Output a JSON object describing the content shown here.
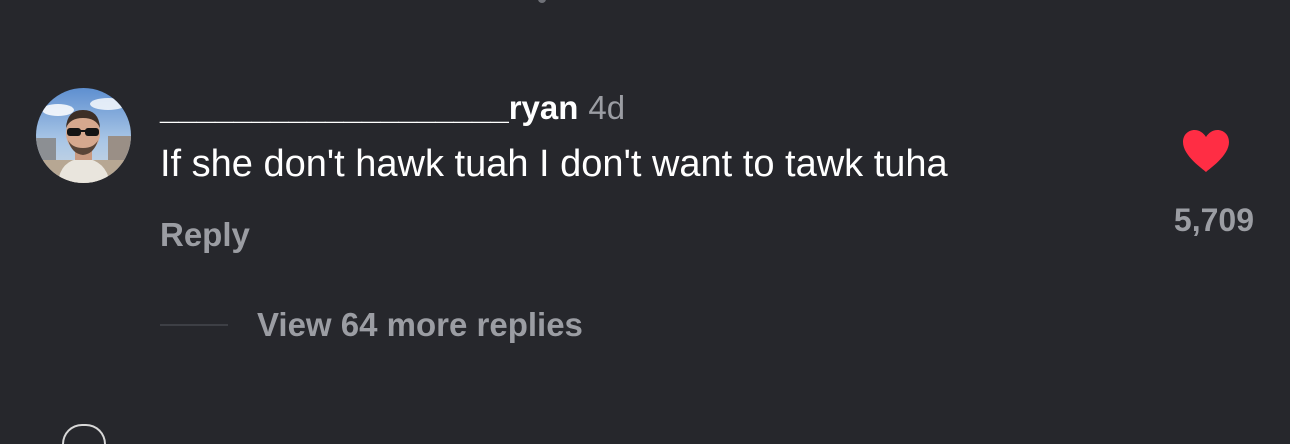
{
  "comment": {
    "username": "___________________ryan",
    "timestamp": "4d",
    "text": "If she don't hawk tuah I don't want to tawk tuha",
    "reply_label": "Reply",
    "like_count": "5,709",
    "liked": true,
    "view_replies_label": "View 64 more replies"
  },
  "colors": {
    "background": "#26272c",
    "primary_text": "#ffffff",
    "secondary_text": "#9b9da3",
    "like_red": "#ff2d44"
  },
  "icons": {
    "like": "heart-filled-icon"
  }
}
